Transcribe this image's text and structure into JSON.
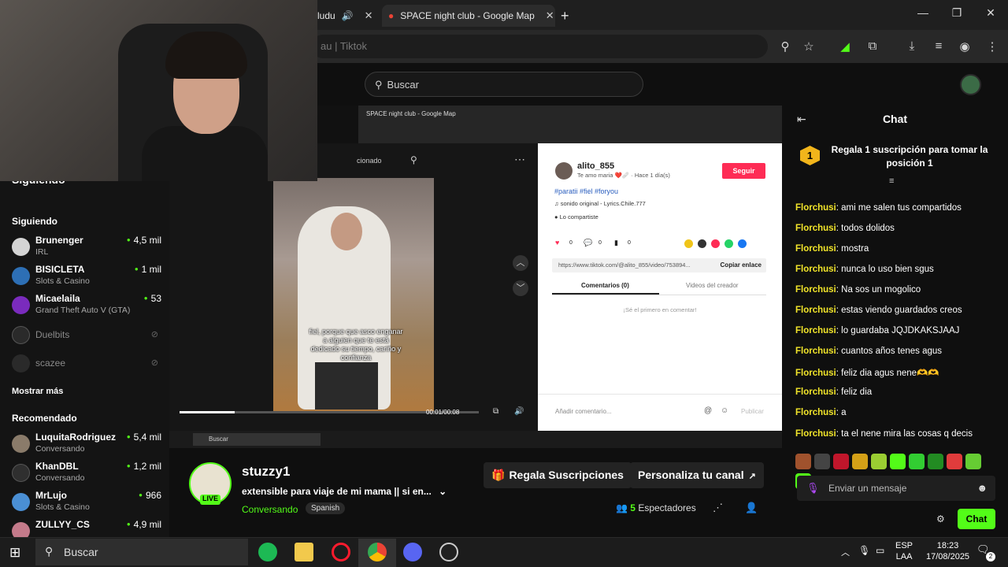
{
  "browser": {
    "tab_partial": "ludu",
    "tab_active": "SPACE night club - Google Map",
    "address_partial": "au | Tiktok"
  },
  "kick": {
    "search_placeholder": "Buscar"
  },
  "sidebar": {
    "following_top": "Siguiendo",
    "following_label": "Siguiendo",
    "following": [
      {
        "name": "Brunenger",
        "category": "IRL",
        "viewers": "4,5 mil",
        "color": "#d4d4d4"
      },
      {
        "name": "BISICLETA",
        "category": "Slots & Casino",
        "viewers": "1 mil",
        "color": "#2d6fb5"
      },
      {
        "name": "Micaelaila",
        "category": "Grand Theft Auto V (GTA)",
        "viewers": "53",
        "color": "#7a2bbd"
      }
    ],
    "offline": [
      {
        "name": "Duelbits"
      },
      {
        "name": "scazee"
      }
    ],
    "show_more": "Mostrar más",
    "recommended_label": "Recomendado",
    "recommended": [
      {
        "name": "LuquitaRodriguez",
        "category": "Conversando",
        "viewers": "5,4 mil",
        "color": "#8a7b6a"
      },
      {
        "name": "KhanDBL",
        "category": "Conversando",
        "viewers": "1,2 mil",
        "color": "#2f2f2f"
      },
      {
        "name": "MrLujo",
        "category": "Slots & Casino",
        "viewers": "966",
        "color": "#4a8fd4"
      },
      {
        "name": "ZULLYY_CS",
        "category": "IRL",
        "viewers": "4,9 mil",
        "color": "#c47a8a"
      }
    ]
  },
  "video": {
    "inner_tab": "SPACE night club - Google Map",
    "subtitle": "fiel, porque que asco enganar a alguien que te está dedicado su tiempo, cariño y confianza",
    "time": "00:01/00:08",
    "tiktok": {
      "user": "alito_855",
      "caption": "Te amo maria ❤️🩹 · Hace 1 día(s)",
      "follow": "Seguir",
      "tags": "#paratii #fiel #foryou",
      "sound": "sonido original - Lyrics.Chile.777",
      "shared": "Lo compartiste",
      "link": "https://www.tiktok.com/@alito_855/video/753894...",
      "copy": "Copiar enlace",
      "tab_comments": "Comentarios (0)",
      "tab_videos": "Videos del creador",
      "empty": "¡Sé el primero en comentar!",
      "add_comment": "Añadir comentario...",
      "publish": "Publicar",
      "likes": "0",
      "comments_count": "0",
      "saves": "0"
    },
    "overlay_label": "cionado"
  },
  "stream": {
    "streamer": "stuzzy1",
    "live": "LIVE",
    "title": "extensible para viaje de mi mama || si en...",
    "category": "Conversando",
    "language": "Spanish",
    "subs_button": "Regala Suscripciones",
    "customize_button": "Personaliza tu canal",
    "viewers_count": "5",
    "viewers_label": "Espectadores"
  },
  "chat": {
    "title": "Chat",
    "gift_rank": "1",
    "gift_text": "Regala 1 suscripción para tomar la posición 1",
    "messages": [
      {
        "user": "Florchusi",
        "text": "ami me salen tus compartidos"
      },
      {
        "user": "Florchusi",
        "text": "todos dolidos"
      },
      {
        "user": "Florchusi",
        "text": "mostra"
      },
      {
        "user": "Florchusi",
        "text": "nunca lo uso bien sgus"
      },
      {
        "user": "Florchusi",
        "text": "Na sos un mogolico"
      },
      {
        "user": "Florchusi",
        "text": "estas viendo guardados creos"
      },
      {
        "user": "Florchusi",
        "text": "lo guardaba JQJDKAKSJAAJ"
      },
      {
        "user": "Florchusi",
        "text": "cuantos años tenes agus"
      },
      {
        "user": "Florchusi",
        "text": "feliz dia agus nene🫶🫶"
      },
      {
        "user": "Florchusi",
        "text": "feliz dia"
      },
      {
        "user": "Florchusi",
        "text": "a"
      },
      {
        "user": "Florchusi",
        "text": "ta el nene mira las cosas q decis"
      }
    ],
    "input_placeholder": "Enviar un mensaje",
    "send_button": "Chat"
  },
  "taskbar": {
    "search": "Buscar",
    "lang_line1": "ESP",
    "lang_line2": "LAA",
    "time": "18:23",
    "date": "17/08/2025",
    "notif_count": "2"
  },
  "colors": {
    "kick_green": "#53fc18",
    "chat_user": "#f2e52a",
    "tiktok_red": "#fe2c55"
  }
}
